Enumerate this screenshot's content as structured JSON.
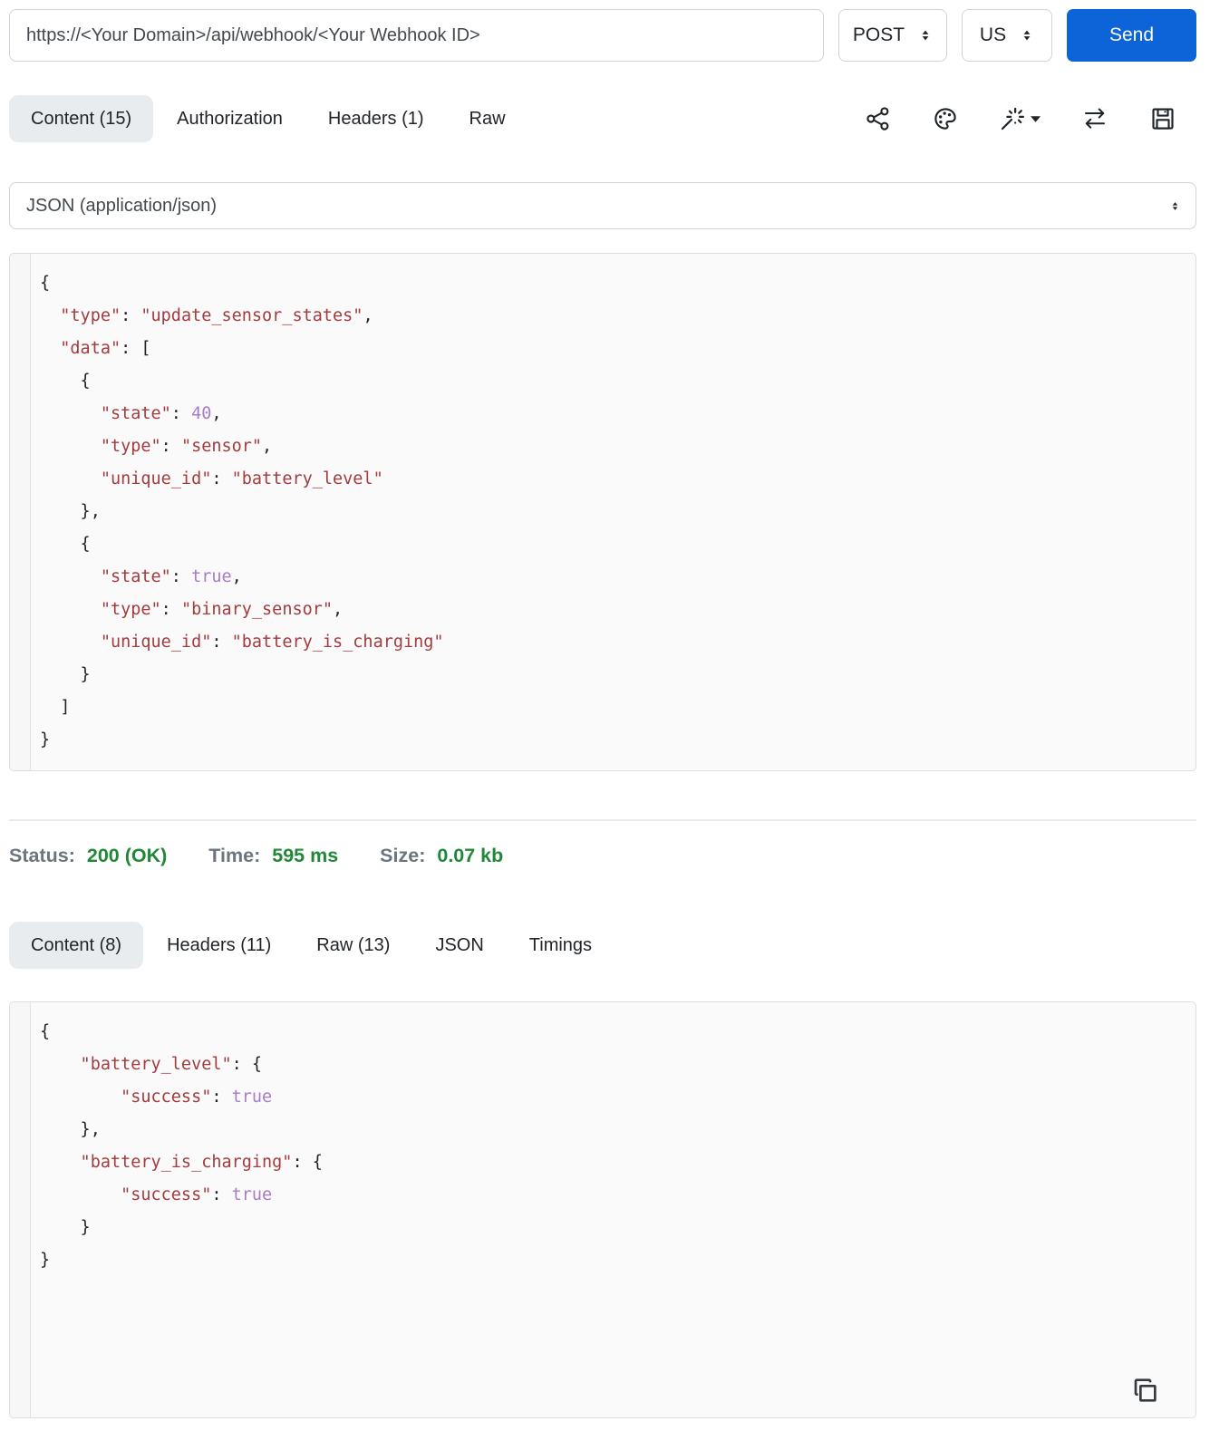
{
  "request_bar": {
    "url": "https://<Your Domain>/api/webhook/<Your Webhook ID>",
    "method": "POST",
    "region": "US",
    "send_label": "Send"
  },
  "request_tabs": [
    {
      "label": "Content (15)",
      "active": true
    },
    {
      "label": "Authorization",
      "active": false
    },
    {
      "label": "Headers (1)",
      "active": false
    },
    {
      "label": "Raw",
      "active": false
    }
  ],
  "toolbar_icons": [
    "share-icon",
    "palette-icon",
    "magic-wand-icon",
    "swap-arrows-icon",
    "save-icon"
  ],
  "content_type_select": {
    "selected": "JSON (application/json)"
  },
  "request_body_lines": [
    [
      [
        "p",
        "{"
      ]
    ],
    [
      [
        "k",
        "  \"type\""
      ],
      [
        "p",
        ": "
      ],
      [
        "s",
        "\"update_sensor_states\""
      ],
      [
        "p",
        ","
      ]
    ],
    [
      [
        "k",
        "  \"data\""
      ],
      [
        "p",
        ": ["
      ]
    ],
    [
      [
        "p",
        "    {"
      ]
    ],
    [
      [
        "k",
        "      \"state\""
      ],
      [
        "p",
        ": "
      ],
      [
        "n",
        "40"
      ],
      [
        "p",
        ","
      ]
    ],
    [
      [
        "k",
        "      \"type\""
      ],
      [
        "p",
        ": "
      ],
      [
        "s",
        "\"sensor\""
      ],
      [
        "p",
        ","
      ]
    ],
    [
      [
        "k",
        "      \"unique_id\""
      ],
      [
        "p",
        ": "
      ],
      [
        "s",
        "\"battery_level\""
      ]
    ],
    [
      [
        "p",
        "    },"
      ]
    ],
    [
      [
        "p",
        "    {"
      ]
    ],
    [
      [
        "k",
        "      \"state\""
      ],
      [
        "p",
        ": "
      ],
      [
        "n",
        "true"
      ],
      [
        "p",
        ","
      ]
    ],
    [
      [
        "k",
        "      \"type\""
      ],
      [
        "p",
        ": "
      ],
      [
        "s",
        "\"binary_sensor\""
      ],
      [
        "p",
        ","
      ]
    ],
    [
      [
        "k",
        "      \"unique_id\""
      ],
      [
        "p",
        ": "
      ],
      [
        "s",
        "\"battery_is_charging\""
      ]
    ],
    [
      [
        "p",
        "    }"
      ]
    ],
    [
      [
        "p",
        "  ]"
      ]
    ],
    [
      [
        "p",
        "}"
      ]
    ]
  ],
  "status_bar": {
    "status_label": "Status:",
    "status_value": "200 (OK)",
    "time_label": "Time:",
    "time_value": "595 ms",
    "size_label": "Size:",
    "size_value": "0.07 kb"
  },
  "response_tabs": [
    {
      "label": "Content (8)",
      "active": true
    },
    {
      "label": "Headers (11)",
      "active": false
    },
    {
      "label": "Raw (13)",
      "active": false
    },
    {
      "label": "JSON",
      "active": false
    },
    {
      "label": "Timings",
      "active": false
    }
  ],
  "response_body_lines": [
    [
      [
        "p",
        "{"
      ]
    ],
    [
      [
        "k",
        "    \"battery_level\""
      ],
      [
        "p",
        ": {"
      ]
    ],
    [
      [
        "k",
        "        \"success\""
      ],
      [
        "p",
        ": "
      ],
      [
        "n",
        "true"
      ]
    ],
    [
      [
        "p",
        "    },"
      ]
    ],
    [
      [
        "k",
        "    \"battery_is_charging\""
      ],
      [
        "p",
        ": {"
      ]
    ],
    [
      [
        "k",
        "        \"success\""
      ],
      [
        "p",
        ": "
      ],
      [
        "n",
        "true"
      ]
    ],
    [
      [
        "p",
        "    }"
      ]
    ],
    [
      [
        "p",
        "}"
      ]
    ]
  ],
  "colors": {
    "accent_blue": "#0d63d8",
    "status_green": "#218838",
    "label_gray": "#6c757d",
    "syntax_red": "#a33b3f",
    "syntax_purple": "#a87cc9",
    "code_background": "#fafafa"
  }
}
